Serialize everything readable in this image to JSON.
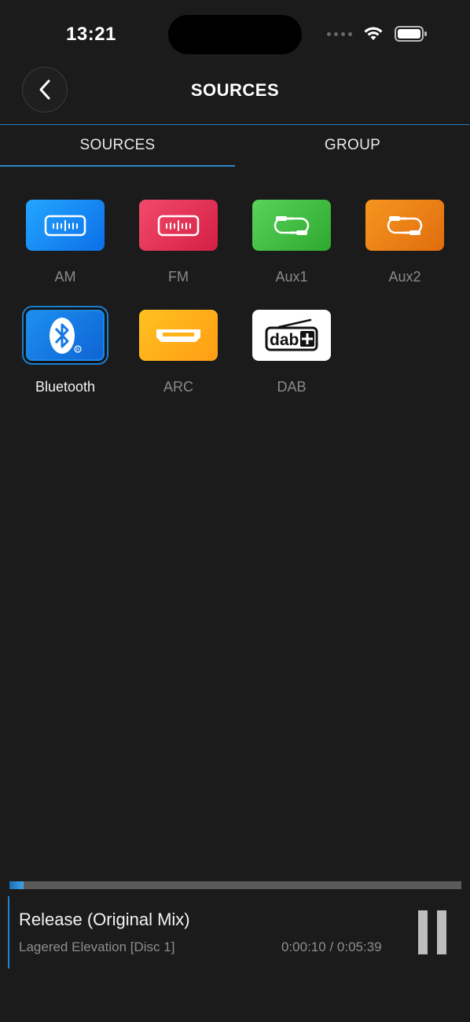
{
  "status": {
    "time": "13:21"
  },
  "header": {
    "title": "SOURCES"
  },
  "tabs": [
    {
      "label": "SOURCES",
      "selected": true
    },
    {
      "label": "GROUP",
      "selected": false
    }
  ],
  "sources": [
    {
      "label": "AM",
      "icon": "radio-tuner-icon",
      "color": "#1a8cff"
    },
    {
      "label": "FM",
      "icon": "radio-tuner-icon",
      "color": "#e8345a"
    },
    {
      "label": "Aux1",
      "icon": "aux-cable-icon",
      "color": "#43c243"
    },
    {
      "label": "Aux2",
      "icon": "aux-cable-icon",
      "color": "#f08418"
    },
    {
      "label": "Bluetooth",
      "icon": "bluetooth-icon",
      "color": "#1479e6",
      "active": true
    },
    {
      "label": "ARC",
      "icon": "hdmi-icon",
      "color": "#ffb41a"
    },
    {
      "label": "DAB",
      "icon": "dab-plus-icon",
      "color": "#ffffff"
    }
  ],
  "now_playing": {
    "title": "Release (Original Mix)",
    "album": "Lagered Elevation [Disc 1]",
    "time": "0:00:10 / 0:05:39",
    "progress": 0.031
  }
}
